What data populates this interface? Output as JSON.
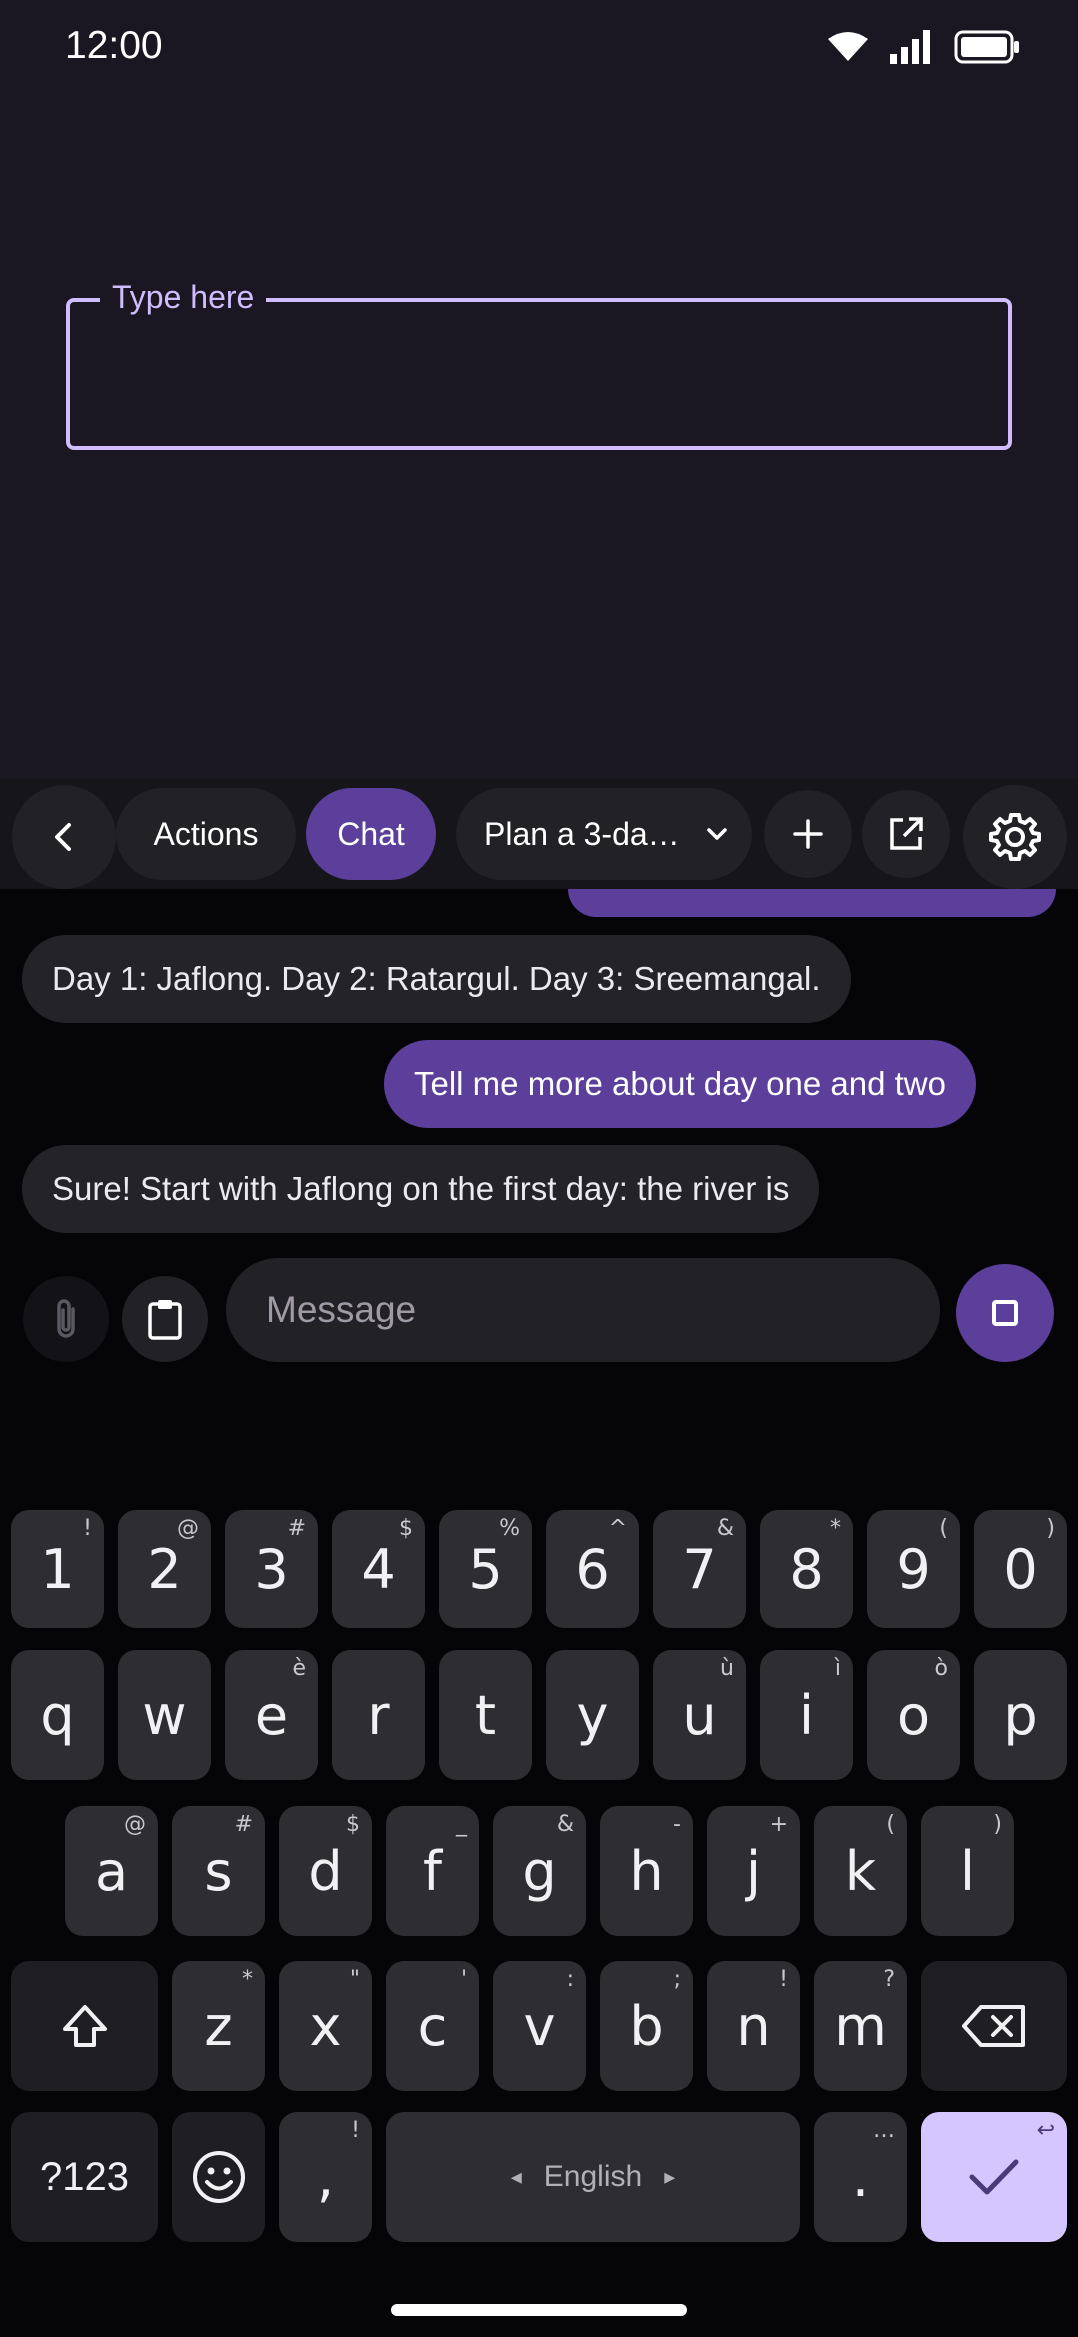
{
  "status_bar": {
    "time": "12:00"
  },
  "text_field": {
    "label": "Type here",
    "value": ""
  },
  "toolbar": {
    "actions_label": "Actions",
    "chat_label": "Chat",
    "conversation_title": "Plan a 3-da…"
  },
  "chat": {
    "messages": [
      {
        "role": "assistant",
        "text": "Day 1: Jaflong. Day 2: Ratargul. Day 3: Sreemangal."
      },
      {
        "role": "user",
        "text": "Tell me more about day one and two"
      },
      {
        "role": "assistant",
        "text": "Sure! Start with Jaflong on the first day: the river is"
      }
    ]
  },
  "composer": {
    "placeholder": "Message"
  },
  "keyboard": {
    "number_row": [
      {
        "key": "1",
        "hint": "!"
      },
      {
        "key": "2",
        "hint": "@"
      },
      {
        "key": "3",
        "hint": "#"
      },
      {
        "key": "4",
        "hint": "$"
      },
      {
        "key": "5",
        "hint": "%"
      },
      {
        "key": "6",
        "hint": "^"
      },
      {
        "key": "7",
        "hint": "&"
      },
      {
        "key": "8",
        "hint": "*"
      },
      {
        "key": "9",
        "hint": "("
      },
      {
        "key": "0",
        "hint": ")"
      }
    ],
    "row1": [
      {
        "key": "q",
        "hint": ""
      },
      {
        "key": "w",
        "hint": ""
      },
      {
        "key": "e",
        "hint": "è"
      },
      {
        "key": "r",
        "hint": ""
      },
      {
        "key": "t",
        "hint": ""
      },
      {
        "key": "y",
        "hint": ""
      },
      {
        "key": "u",
        "hint": "ù"
      },
      {
        "key": "i",
        "hint": "ì"
      },
      {
        "key": "o",
        "hint": "ò"
      },
      {
        "key": "p",
        "hint": ""
      }
    ],
    "row2": [
      {
        "key": "a",
        "hint": "@"
      },
      {
        "key": "s",
        "hint": "#"
      },
      {
        "key": "d",
        "hint": "$"
      },
      {
        "key": "f",
        "hint": "_"
      },
      {
        "key": "g",
        "hint": "&"
      },
      {
        "key": "h",
        "hint": "-"
      },
      {
        "key": "j",
        "hint": "+"
      },
      {
        "key": "k",
        "hint": "("
      },
      {
        "key": "l",
        "hint": ")"
      }
    ],
    "row3": [
      {
        "key": "z",
        "hint": "*"
      },
      {
        "key": "x",
        "hint": "\""
      },
      {
        "key": "c",
        "hint": "'"
      },
      {
        "key": "v",
        "hint": ":"
      },
      {
        "key": "b",
        "hint": ";"
      },
      {
        "key": "n",
        "hint": "!"
      },
      {
        "key": "m",
        "hint": "?"
      }
    ],
    "symbols_label": "?123",
    "comma": ",",
    "comma_hint": "!",
    "space_label": "English",
    "space_left_arrow": "◂",
    "space_right_arrow": "▸",
    "period": ".",
    "period_hint": "…",
    "enter_hint": "↩"
  },
  "icons": {
    "back": "chevron-left-icon",
    "dropdown": "chevron-down-icon",
    "add": "plus-icon",
    "open_external": "open-in-new-icon",
    "settings": "gear-icon",
    "attach": "paperclip-icon",
    "clipboard": "clipboard-icon",
    "stop": "stop-icon",
    "shift": "shift-icon",
    "backspace": "backspace-icon",
    "emoji": "emoji-icon",
    "enter": "check-icon"
  },
  "colors": {
    "accent": "#5b3f9a",
    "field_outline": "#cfbdfe",
    "enter_key": "#d6c6ff"
  }
}
